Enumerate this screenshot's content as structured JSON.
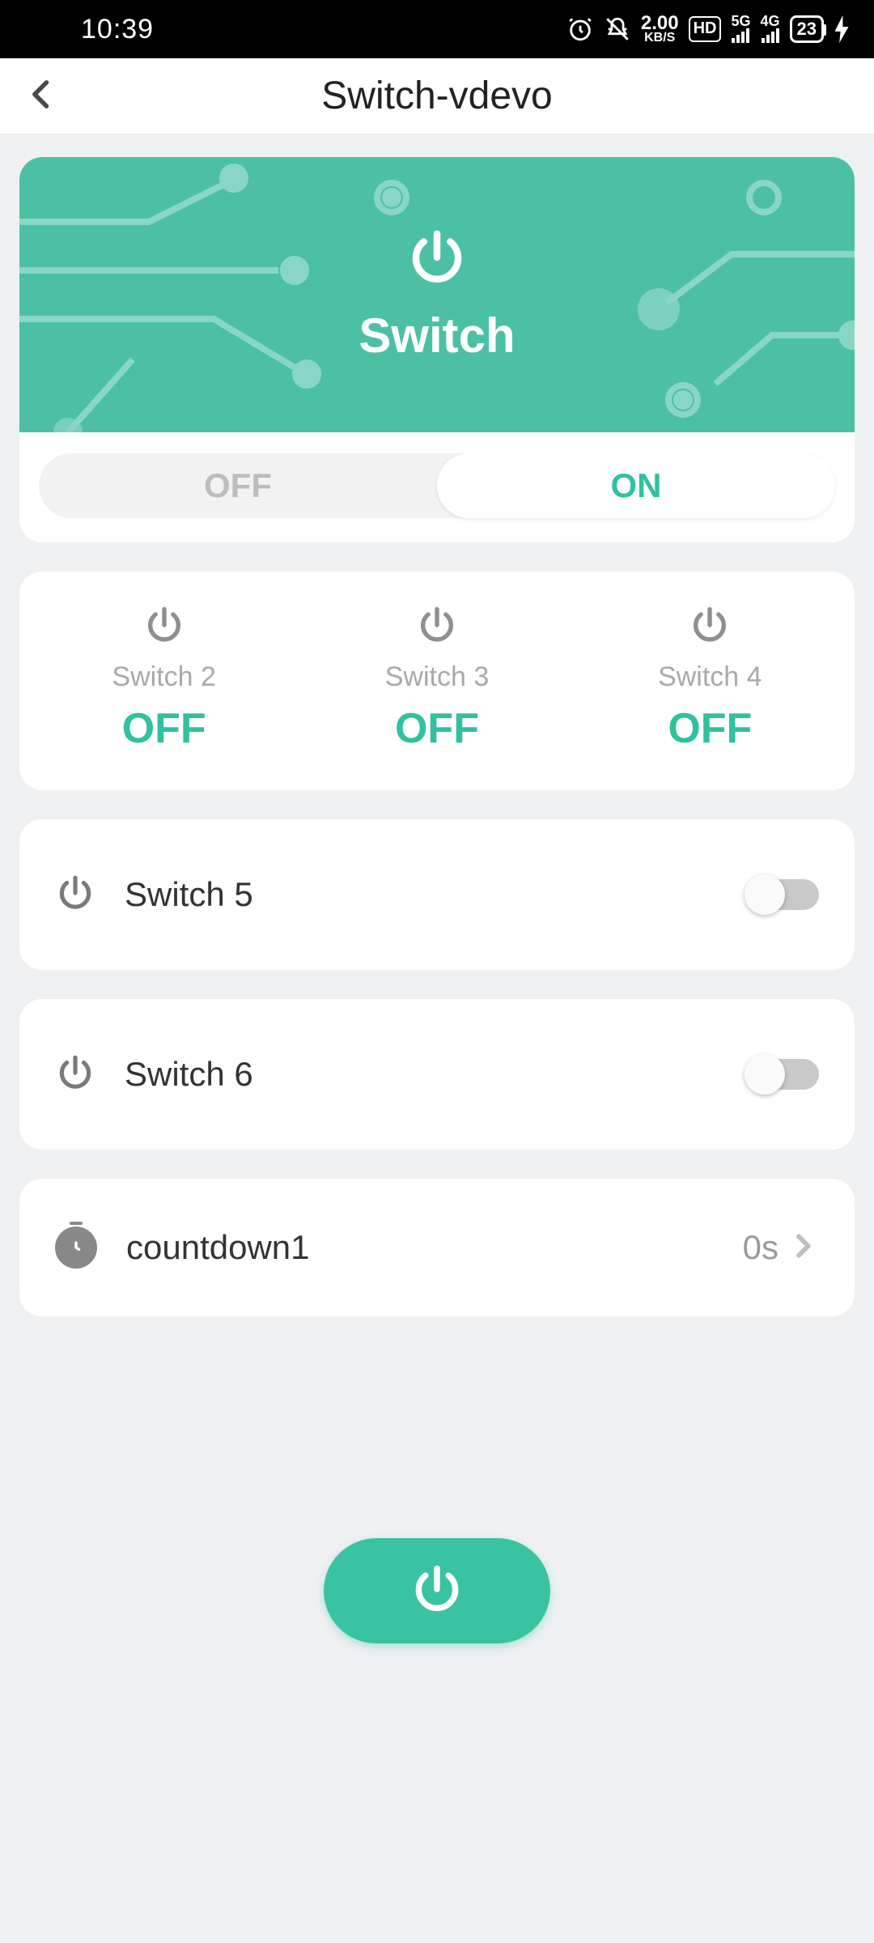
{
  "status": {
    "time": "10:39",
    "net_rate_top": "2.00",
    "net_rate_bot": "KB/S",
    "hd": "HD",
    "sig1": "5G",
    "sig2": "4G",
    "battery": "23"
  },
  "header": {
    "title": "Switch-vdevo"
  },
  "hero": {
    "label": "Switch",
    "seg_off": "OFF",
    "seg_on": "ON",
    "active_segment": "ON"
  },
  "switch_grid": [
    {
      "label": "Switch 2",
      "state": "OFF"
    },
    {
      "label": "Switch 3",
      "state": "OFF"
    },
    {
      "label": "Switch 4",
      "state": "OFF"
    }
  ],
  "rows": {
    "switch5": "Switch 5",
    "switch6": "Switch 6"
  },
  "countdown": {
    "label": "countdown1",
    "value": "0s"
  }
}
